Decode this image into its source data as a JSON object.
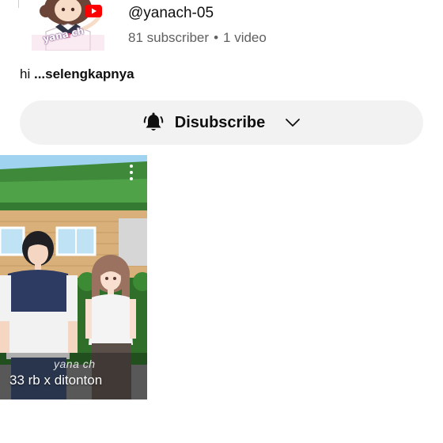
{
  "channel": {
    "handle": "@yanach-05",
    "subscribers": "81 subscriber",
    "separator": "•",
    "video_count": "1 video",
    "avatar_text": "yana ch"
  },
  "description": {
    "text": "hi ",
    "more_label": "...selengkapnya"
  },
  "subscribe": {
    "label": "Disubscribe",
    "bell_icon": "bell-ringing-icon",
    "dropdown_icon": "chevron-down-icon"
  },
  "video": {
    "views": "33 rb x ditonton",
    "watermark": "yana ch",
    "menu_icon": "more-vert-icon"
  },
  "colors": {
    "pill_bg": "#f2f2f2",
    "meta_text": "#606060",
    "youtube_red": "#ff0000"
  }
}
